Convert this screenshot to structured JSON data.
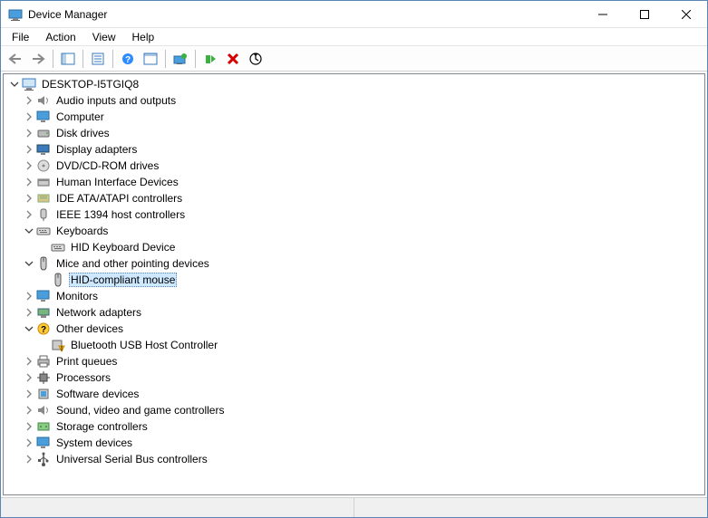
{
  "window": {
    "title": "Device Manager"
  },
  "menu": {
    "file": "File",
    "action": "Action",
    "view": "View",
    "help": "Help"
  },
  "tree": {
    "root": "DESKTOP-I5TGIQ8",
    "audio": "Audio inputs and outputs",
    "computer": "Computer",
    "disk": "Disk drives",
    "display": "Display adapters",
    "dvd": "DVD/CD-ROM drives",
    "hid": "Human Interface Devices",
    "ide": "IDE ATA/ATAPI controllers",
    "ieee1394": "IEEE 1394 host controllers",
    "keyboards": "Keyboards",
    "keyboards_child": "HID Keyboard Device",
    "mice": "Mice and other pointing devices",
    "mice_child": "HID-compliant mouse",
    "monitors": "Monitors",
    "network": "Network adapters",
    "other": "Other devices",
    "other_child": "Bluetooth USB Host Controller",
    "printq": "Print queues",
    "processors": "Processors",
    "software": "Software devices",
    "sound": "Sound, video and game controllers",
    "storage": "Storage controllers",
    "system": "System devices",
    "usb": "Universal Serial Bus controllers"
  }
}
